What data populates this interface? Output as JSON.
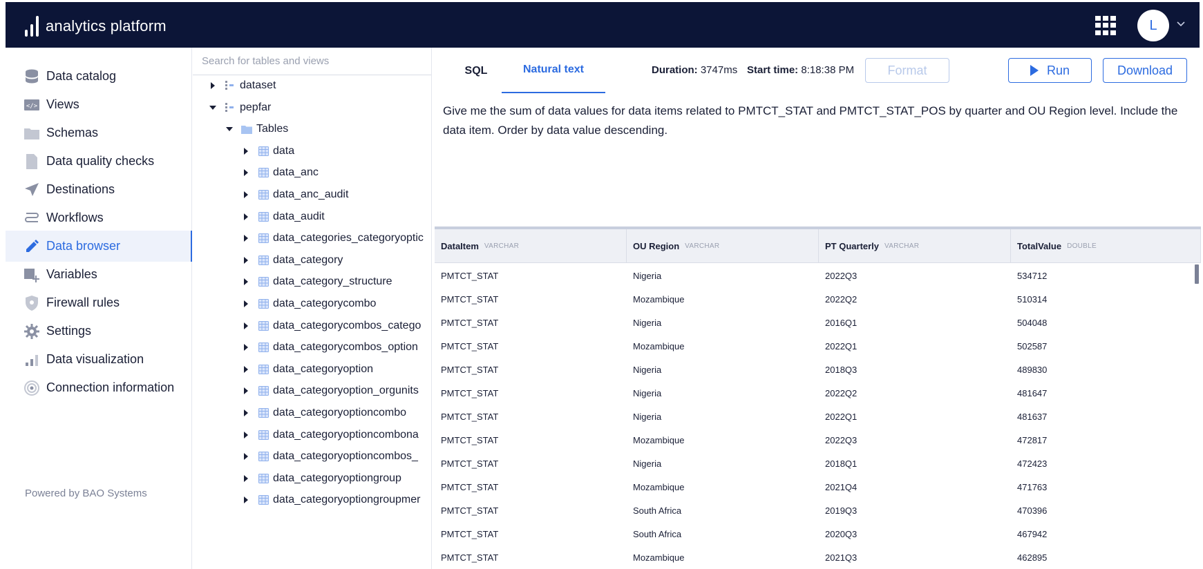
{
  "app": {
    "brand": "analytics platform",
    "user_initial": "L",
    "powered_by": "Powered by BAO Systems"
  },
  "sidebar": {
    "items": [
      {
        "label": "Data catalog",
        "icon": "database-icon"
      },
      {
        "label": "Views",
        "icon": "code-icon"
      },
      {
        "label": "Schemas",
        "icon": "folder-icon"
      },
      {
        "label": "Data quality checks",
        "icon": "document-icon"
      },
      {
        "label": "Destinations",
        "icon": "send-icon"
      },
      {
        "label": "Workflows",
        "icon": "workflow-icon"
      },
      {
        "label": "Data browser",
        "icon": "pencil-icon",
        "active": true
      },
      {
        "label": "Variables",
        "icon": "add-variable-icon"
      },
      {
        "label": "Firewall rules",
        "icon": "shield-icon"
      },
      {
        "label": "Settings",
        "icon": "gear-icon"
      },
      {
        "label": "Data visualization",
        "icon": "bar-chart-icon"
      },
      {
        "label": "Connection information",
        "icon": "broadcast-icon"
      }
    ]
  },
  "tree": {
    "search_placeholder": "Search for tables and views",
    "rows": [
      {
        "label": "dataset",
        "level": 0,
        "expanded": false,
        "type": "schema"
      },
      {
        "label": "pepfar",
        "level": 0,
        "expanded": true,
        "type": "schema"
      },
      {
        "label": "Tables",
        "level": 1,
        "expanded": true,
        "type": "folder"
      },
      {
        "label": "data",
        "level": 2,
        "expanded": false,
        "type": "table"
      },
      {
        "label": "data_anc",
        "level": 2,
        "expanded": false,
        "type": "table"
      },
      {
        "label": "data_anc_audit",
        "level": 2,
        "expanded": false,
        "type": "table"
      },
      {
        "label": "data_audit",
        "level": 2,
        "expanded": false,
        "type": "table"
      },
      {
        "label": "data_categories_categoryoptic",
        "level": 2,
        "expanded": false,
        "type": "table"
      },
      {
        "label": "data_category",
        "level": 2,
        "expanded": false,
        "type": "table"
      },
      {
        "label": "data_category_structure",
        "level": 2,
        "expanded": false,
        "type": "table"
      },
      {
        "label": "data_categorycombo",
        "level": 2,
        "expanded": false,
        "type": "table"
      },
      {
        "label": "data_categorycombos_catego",
        "level": 2,
        "expanded": false,
        "type": "table"
      },
      {
        "label": "data_categorycombos_option",
        "level": 2,
        "expanded": false,
        "type": "table"
      },
      {
        "label": "data_categoryoption",
        "level": 2,
        "expanded": false,
        "type": "table"
      },
      {
        "label": "data_categoryoption_orgunits",
        "level": 2,
        "expanded": false,
        "type": "table"
      },
      {
        "label": "data_categoryoptioncombo",
        "level": 2,
        "expanded": false,
        "type": "table"
      },
      {
        "label": "data_categoryoptioncombona",
        "level": 2,
        "expanded": false,
        "type": "table"
      },
      {
        "label": "data_categoryoptioncombos_",
        "level": 2,
        "expanded": false,
        "type": "table"
      },
      {
        "label": "data_categoryoptiongroup",
        "level": 2,
        "expanded": false,
        "type": "table"
      },
      {
        "label": "data_categoryoptiongroupmer",
        "level": 2,
        "expanded": false,
        "type": "table"
      }
    ]
  },
  "query": {
    "tab_sql": "SQL",
    "tab_natural": "Natural text",
    "duration_label": "Duration:",
    "duration_value": "3747ms",
    "start_label": "Start time:",
    "start_value": "8:18:38 PM",
    "format_label": "Format",
    "run_label": "Run",
    "download_label": "Download",
    "text": "Give me the sum of data values for data items related to PMTCT_STAT and PMTCT_STAT_POS by quarter and OU Region level. Include the data item. Order by data value descending."
  },
  "results": {
    "columns": [
      {
        "name": "DataItem",
        "type": "VARCHAR"
      },
      {
        "name": "OU Region",
        "type": "VARCHAR"
      },
      {
        "name": "PT Quarterly",
        "type": "VARCHAR"
      },
      {
        "name": "TotalValue",
        "type": "DOUBLE"
      }
    ],
    "rows": [
      [
        "PMTCT_STAT",
        "Nigeria",
        "2022Q3",
        "534712"
      ],
      [
        "PMTCT_STAT",
        "Mozambique",
        "2022Q2",
        "510314"
      ],
      [
        "PMTCT_STAT",
        "Nigeria",
        "2016Q1",
        "504048"
      ],
      [
        "PMTCT_STAT",
        "Mozambique",
        "2022Q1",
        "502587"
      ],
      [
        "PMTCT_STAT",
        "Nigeria",
        "2018Q3",
        "489830"
      ],
      [
        "PMTCT_STAT",
        "Nigeria",
        "2022Q2",
        "481647"
      ],
      [
        "PMTCT_STAT",
        "Nigeria",
        "2022Q1",
        "481637"
      ],
      [
        "PMTCT_STAT",
        "Mozambique",
        "2022Q3",
        "472817"
      ],
      [
        "PMTCT_STAT",
        "Nigeria",
        "2018Q1",
        "472423"
      ],
      [
        "PMTCT_STAT",
        "Mozambique",
        "2021Q4",
        "471763"
      ],
      [
        "PMTCT_STAT",
        "South Africa",
        "2019Q3",
        "470396"
      ],
      [
        "PMTCT_STAT",
        "South Africa",
        "2020Q3",
        "467942"
      ],
      [
        "PMTCT_STAT",
        "Mozambique",
        "2021Q3",
        "462895"
      ]
    ]
  },
  "colors": {
    "header_bg": "#0c1537",
    "accent": "#2c6be0",
    "muted": "#9aa0b0"
  }
}
